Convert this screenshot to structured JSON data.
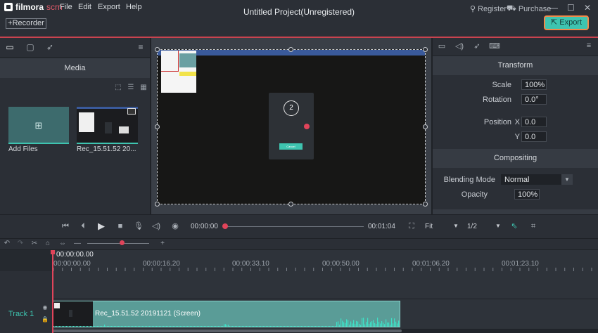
{
  "app": {
    "logo_text": "filmora",
    "logo_accent": "scrn",
    "title": "Untitled Project(Unregistered)"
  },
  "menu": {
    "file": "File",
    "edit": "Edit",
    "export": "Export",
    "help": "Help"
  },
  "account": {
    "register": "Register",
    "purchase": "Purchase"
  },
  "window_controls": {
    "minimize": "—",
    "maximize": "☐",
    "close": "✕"
  },
  "toolbar": {
    "recorder_label": "+Recorder",
    "export_label": "Export"
  },
  "media": {
    "title": "Media",
    "items": [
      {
        "label": "Add Files"
      },
      {
        "label": "Rec_15.51.52 20..."
      }
    ]
  },
  "properties": {
    "transform": {
      "title": "Transform",
      "scale_label": "Scale",
      "scale_value": "100%",
      "rotation_label": "Rotation",
      "rotation_value": "0.0°",
      "position_label": "Position",
      "x_label": "X",
      "x_value": "0.0",
      "y_label": "Y",
      "y_value": "0.0"
    },
    "compositing": {
      "title": "Compositing",
      "blending_label": "Blending Mode",
      "blending_value": "Normal",
      "opacity_label": "Opacity",
      "opacity_value": "100%"
    }
  },
  "preview": {
    "dialog_count": "2",
    "cancel_label": "Cancel"
  },
  "transport": {
    "current_time": "00:00:00",
    "total_time": "00:01:04",
    "fit": "Fit",
    "ratio": "1/2",
    "progress": 0.0
  },
  "timeline": {
    "playhead_time": "00:00:00.00",
    "ruler_labels": [
      "00:00:00.00",
      "00:00:16.20",
      "00:00:33.10",
      "00:00:50.00",
      "00:01:06.20",
      "00:01:23.10"
    ],
    "tracks": [
      {
        "label": "Track 1",
        "clip_label": "Rec_15.51.52 20191121 (Screen)"
      }
    ]
  },
  "colors": {
    "accent": "#3ec4b0",
    "playhead": "#e0445a",
    "export_border": "#f08a4b"
  }
}
